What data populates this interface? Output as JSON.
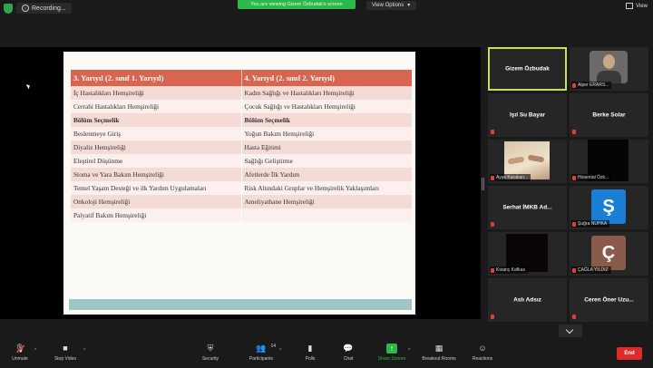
{
  "topbar": {
    "recording_label": "Recording...",
    "viewing_text": "You are viewing Gizem Özbudak's screen",
    "view_options": "View Options",
    "view_label": "View"
  },
  "slide": {
    "headers": [
      "3. Yarıyıl (2. sınıf 1. Yarıyıl)",
      "4. Yarıyıl (2. sınıf 2. Yarıyıl)"
    ],
    "rows": [
      [
        "İç Hastalıkları Hemşireliği",
        "Kadın Sağlığı ve Hastalıkları Hemşireliği"
      ],
      [
        "Cerrahi Hastalıkları Hemşireliği",
        "Çocuk Sağlığı ve Hastalıkları Hemşireliği"
      ],
      [
        "Bölüm Seçmelik",
        "Bölüm Seçmelik"
      ],
      [
        "Beslenmeye Giriş",
        "Yoğun Bakım Hemşireliği"
      ],
      [
        "Diyaliz Hemşireliği",
        "Hasta Eğitimi"
      ],
      [
        "Eleştirel Düşünme",
        "Sağlığı Geliştirme"
      ],
      [
        "Stoma ve Yara Bakım Hemşireliği",
        "Afetlerde İlk Yardım"
      ],
      [
        "Temel Yaşam Desteği ve ilk Yardım Uygulamaları",
        "Risk Altındaki Gruplar ve Hemşirelik Yaklaşımları"
      ],
      [
        "Onkoloji Hemşireliği",
        "Ameliyathane Hemşireliği"
      ],
      [
        "Palyatif Bakım Hemşireliği",
        ""
      ]
    ]
  },
  "gallery": {
    "tiles": [
      {
        "name": "Gizem Özbudak",
        "label": ""
      },
      {
        "name": "",
        "label": "Alper ERARS..."
      },
      {
        "name": "Işıl Su Bayar",
        "label": ""
      },
      {
        "name": "Berke Solar",
        "label": ""
      },
      {
        "name": "",
        "label": "Ayşe Karakan..."
      },
      {
        "name": "",
        "label": "Hosental Özk..."
      },
      {
        "name": "Serhat İMKB Ad...",
        "label": ""
      },
      {
        "name": "",
        "label": "Şuğra NUHKA",
        "avatar": "Ş",
        "avatar_color": "#1a7fd4"
      },
      {
        "name": "",
        "label": "Kıvanç Kafkas"
      },
      {
        "name": "",
        "label": "ÇAĞLA YILDIZ",
        "avatar": "Ç",
        "avatar_color": "#8a5a4a"
      },
      {
        "name": "Aslı Adsız",
        "label": ""
      },
      {
        "name": "Ceren Öner Uzu...",
        "label": ""
      }
    ]
  },
  "toolbar": {
    "items": [
      {
        "label": "Unmute",
        "icon": "microphone-icon"
      },
      {
        "label": "Stop Video",
        "icon": "video-camera-icon"
      },
      {
        "label": "Security",
        "icon": "shield-icon"
      },
      {
        "label": "Participants",
        "icon": "participants-icon",
        "count": "14"
      },
      {
        "label": "Polls",
        "icon": "polls-icon"
      },
      {
        "label": "Chat",
        "icon": "chat-icon"
      },
      {
        "label": "Share Screen",
        "icon": "share-screen-icon"
      },
      {
        "label": "Breakout Rooms",
        "icon": "breakout-rooms-icon"
      },
      {
        "label": "Reactions",
        "icon": "reactions-icon"
      }
    ],
    "end_label": "End"
  },
  "colors": {
    "header_red": "#d96450",
    "share_green": "#2db84a",
    "active_speaker": "#c8e05a",
    "end_red": "#e02a2a"
  }
}
